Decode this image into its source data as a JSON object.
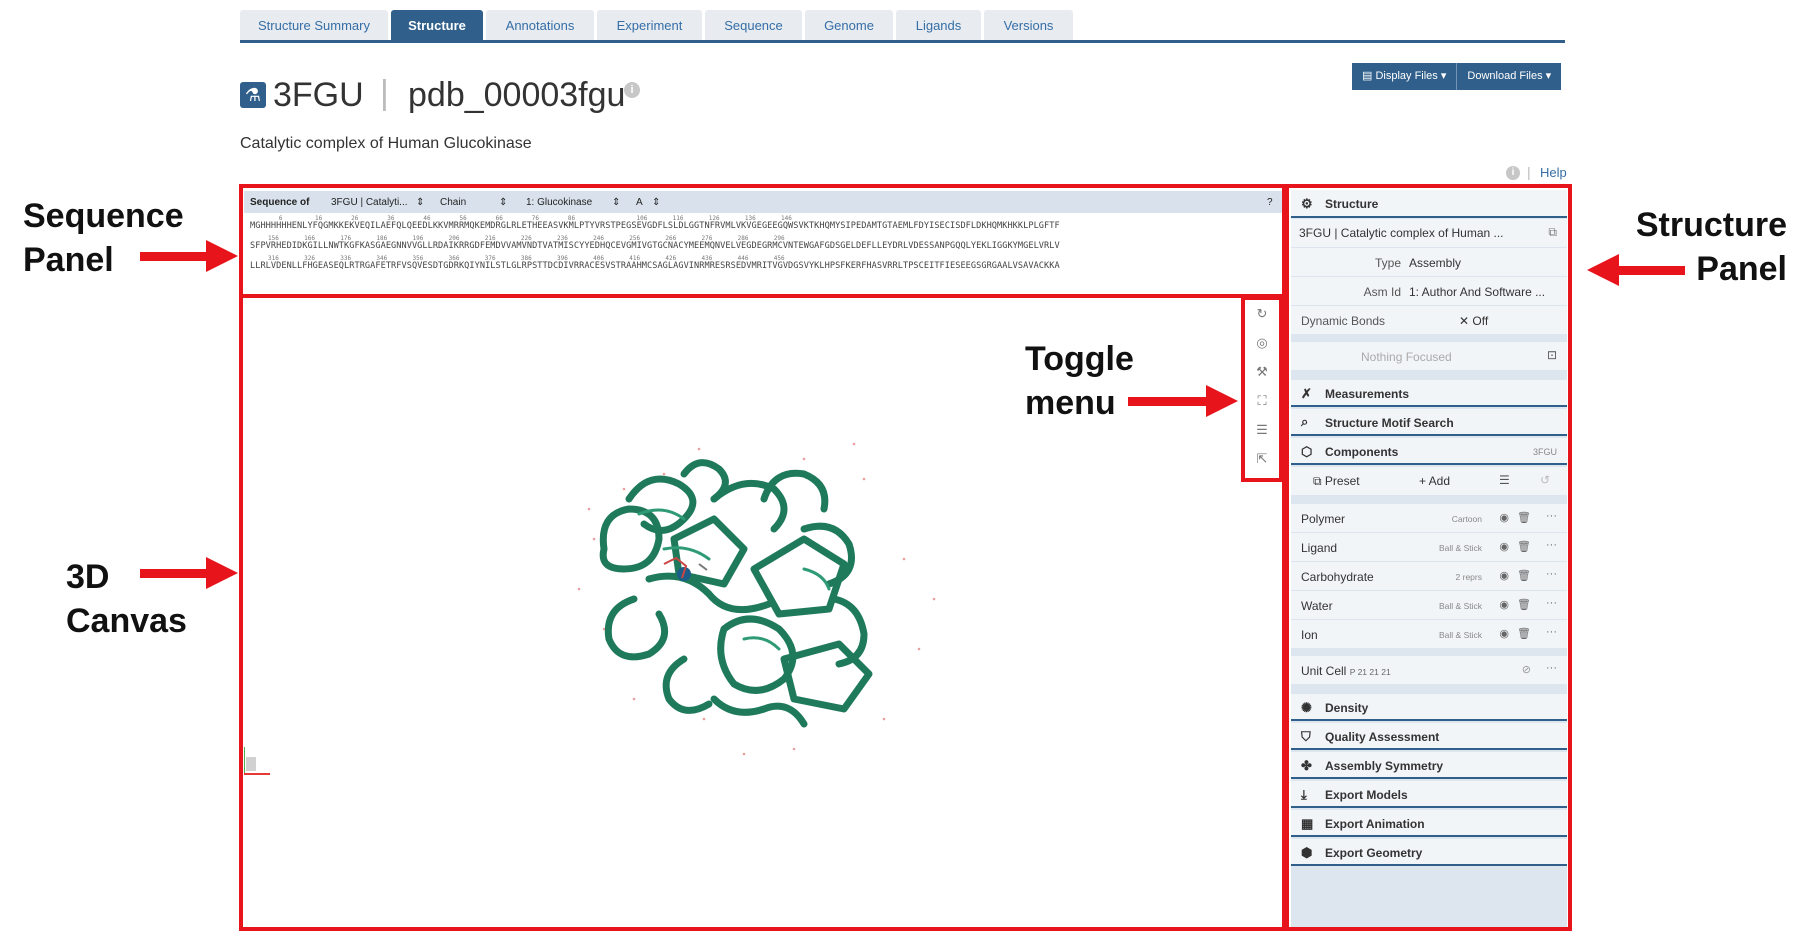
{
  "tabs": [
    {
      "label": "Structure Summary",
      "active": false
    },
    {
      "label": "Structure",
      "active": true
    },
    {
      "label": "Annotations",
      "active": false
    },
    {
      "label": "Experiment",
      "active": false
    },
    {
      "label": "Sequence",
      "active": false
    },
    {
      "label": "Genome",
      "active": false
    },
    {
      "label": "Ligands",
      "active": false
    },
    {
      "label": "Versions",
      "active": false
    }
  ],
  "entry": {
    "id": "3FGU",
    "separator": "|",
    "pdb_id": "pdb_00003fgu",
    "description": "Catalytic complex of Human Glucokinase"
  },
  "file_buttons": {
    "display": "Display Files ▾",
    "download": "Download Files ▾"
  },
  "help": {
    "sep": "|",
    "label": "Help"
  },
  "sequence_panel": {
    "label": "Sequence of",
    "entity_select": "3FGU | Catalyti...",
    "chain_label": "Chain",
    "chain_select": "1: Glucokinase",
    "chain_id": "A",
    "line1": "MGHHHHHHENLYFQGMKKEKVEQILAEFQLQEEDLKKVMRRMQKEMDRGLRLETHEEASVKMLPTYVRSTPEGSEVGDFLSLDLGGTNFRVMLVKVGEGEEGQWSVKTKHQMYSIPEDAMTGTAEMLFDYISECISDFLDKHQMKHKKLPLGFTF",
    "line2": "SFPVRHEDIDKGILLNWTKGFKASGAEGNNVVGLLRDAIKRRGDFEMDVVAMVNDTVATMISCYYEDHQCEVGMIVGTGCNACYMEEMQNVELVEGDEGRMCVNTEWGAFGDSGELDEFLLEYDRLVDESSANPGQQLYEKLIGGKYMGELVRLV",
    "line3": "LLRLVDENLLFHGEASEQLRTRGAFETRFVSQVESDTGDRKQIYNILSTLGLRPSTTDCDIVRRACESVSTRAAHMCSAGLAGVINRMRESRSEDVMRITVGVDGSVYKLHPSFKERFHASVRRLTPSCEITFIESEEGSGRGAALVSAVACKKA",
    "nums1": "        6         16        26        36        46        56        66        76        86                 106       116       126       136       146",
    "nums2": "     156       166       176       186       196       206       216       226       236       246       256       266       276       286       296",
    "nums3": "     316       326       336       346       356       366       376       386       396       406       416       426       436       446       456"
  },
  "structure_panel": {
    "structure_header": "Structure",
    "structure_select": "3FGU | Catalytic complex of Human ...",
    "type_label": "Type",
    "type_value": "Assembly",
    "asm_label": "Asm Id",
    "asm_value": "1: Author And Software ...",
    "dyn_label": "Dynamic Bonds",
    "dyn_value": "✕  Off",
    "focus": "Nothing Focused",
    "measurements": "Measurements",
    "motif_search": "Structure Motif Search",
    "components": "Components",
    "components_tag": "3FGU",
    "preset": "Preset",
    "add": "+ Add",
    "component_list": [
      {
        "name": "Polymer",
        "repr": "Cartoon"
      },
      {
        "name": "Ligand",
        "repr": "Ball & Stick"
      },
      {
        "name": "Carbohydrate",
        "repr": "2 reprs"
      },
      {
        "name": "Water",
        "repr": "Ball & Stick"
      },
      {
        "name": "Ion",
        "repr": "Ball & Stick"
      }
    ],
    "unit_cell": "Unit Cell",
    "unit_cell_group": "P 21 21 21",
    "density": "Density",
    "quality": "Quality Assessment",
    "symmetry": "Assembly Symmetry",
    "export_models": "Export Models",
    "export_animation": "Export Animation",
    "export_geometry": "Export Geometry"
  },
  "annotations": {
    "sequence_panel_1": "Sequence",
    "sequence_panel_2": "Panel",
    "structure_panel_1": "Structure",
    "structure_panel_2": "Panel",
    "toggle_menu_1": "Toggle",
    "toggle_menu_2": "menu",
    "canvas_1": "3D",
    "canvas_2": "Canvas"
  },
  "colors": {
    "accent": "#2f5f8a",
    "annotation_red": "#e8141b",
    "protein_green": "#1f7a5c"
  }
}
